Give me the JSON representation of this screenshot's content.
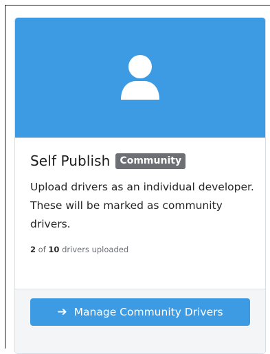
{
  "card": {
    "icon": "user-icon",
    "title": "Self Publish",
    "badge": "Community",
    "description": "Upload drivers as an individual developer. These will be marked as community drivers.",
    "uploaded_count": "2",
    "of_text": "of",
    "limit": "10",
    "uploaded_suffix": "drivers uploaded",
    "button_icon": "arrow-right-icon",
    "button_label": "Manage Community Drivers"
  },
  "colors": {
    "accent": "#3d9be3",
    "badge_bg": "#6c6f74"
  }
}
